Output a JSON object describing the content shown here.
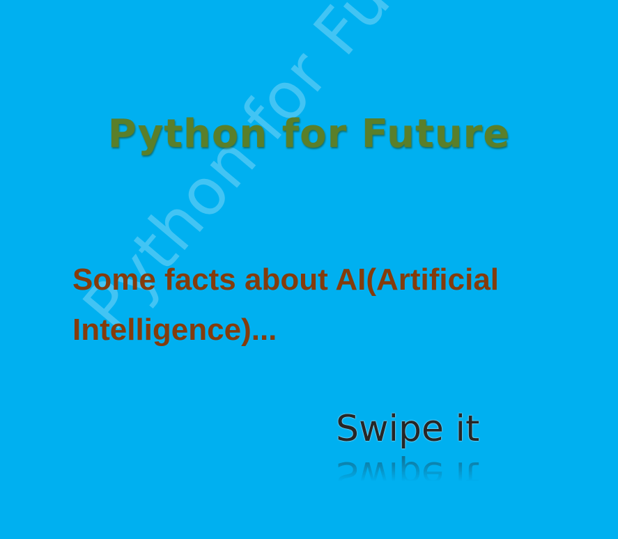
{
  "slide": {
    "watermark": "Python for Future",
    "title": "Python for Future",
    "facts_line1": "Some facts about AI(Artificial",
    "facts_line2": "Intelligence)...",
    "swipe": "Swipe it"
  },
  "colors": {
    "background": "#00b0f0",
    "title": "#5a7f2a",
    "facts": "#843c0c",
    "swipe": "#262626"
  }
}
